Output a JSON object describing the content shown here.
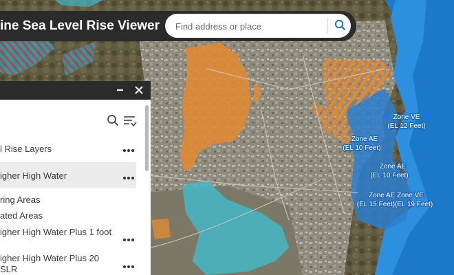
{
  "app": {
    "title": "ine Sea Level Rise Viewer"
  },
  "search": {
    "placeholder": "Find address or place"
  },
  "map": {
    "labels": [
      {
        "line1": "Zone VE",
        "line2": "(EL 12 Feet)"
      },
      {
        "line1": "Zone AE",
        "line2": "(EL 10 Feet)"
      },
      {
        "line1": "Zone AE",
        "line2": "(EL 10 Feet)"
      },
      {
        "line1": "Zone AE  Zone VE",
        "line2": "(EL 15 Feet)(EL 19 Feet)"
      }
    ]
  },
  "layers": {
    "items": [
      {
        "label": "l Rise Layers",
        "has_menu": true
      },
      {
        "label": "igher High Water",
        "has_menu": true,
        "selected": true
      },
      {
        "label": "ring Areas",
        "has_menu": false
      },
      {
        "label": "ated Areas",
        "has_menu": false
      },
      {
        "label": "igher High Water Plus 1 foot",
        "has_menu": true
      },
      {
        "label": "igher High Water Plus 20 SLR",
        "has_menu": true
      }
    ]
  },
  "colors": {
    "bar": "#2b2b2b",
    "accent": "#1f78b4",
    "flood_orange": "#e08a35",
    "flood_cyan": "#45b7c6",
    "sea": "#1c78c8"
  },
  "icons": {
    "search": "search-icon",
    "close": "close-icon",
    "minimize": "minimize-icon",
    "filter": "filter-icon",
    "menu": "more-horizontal-icon"
  }
}
